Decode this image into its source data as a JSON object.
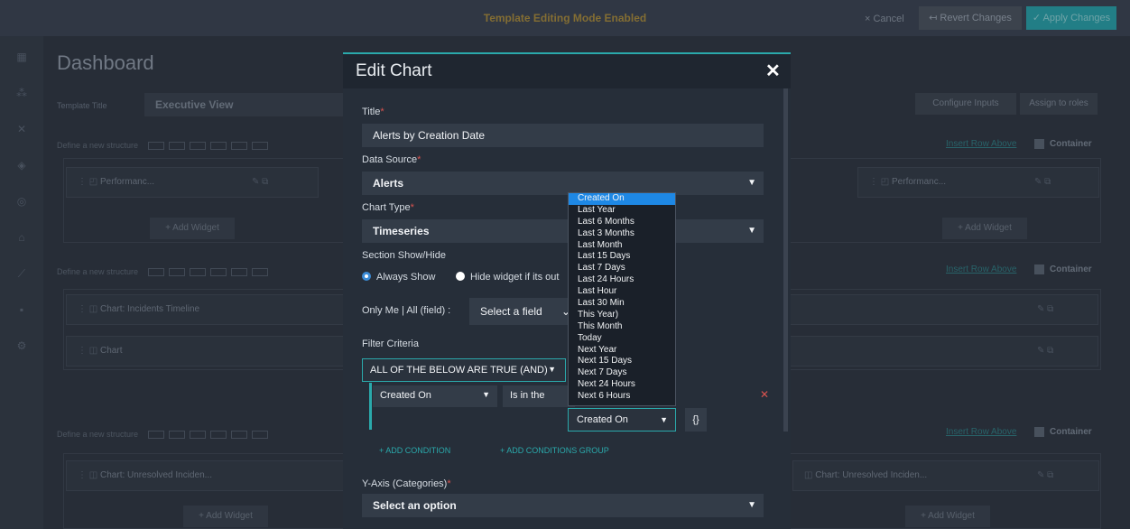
{
  "topbar": {
    "mode_text": "Template Editing Mode Enabled",
    "cancel_label": "× Cancel",
    "revert_label": "↤ Revert Changes",
    "apply_label": "✓ Apply Changes"
  },
  "dashboard": {
    "title": "Dashboard",
    "template_title_label": "Template Title",
    "template_title_value": "Executive View",
    "configure_inputs_label": "Configure Inputs",
    "assign_roles_label": "Assign to roles",
    "define_structure_label": "Define a new structure",
    "insert_row_label": "Insert Row Above",
    "container_label": "Container",
    "add_widget_label": "+ Add Widget",
    "row1_widgets": [
      "Performanc...",
      "Performanc..."
    ],
    "row2_widgets": [
      "Chart: Incidents Timeline",
      "Chart"
    ],
    "row3_widgets": [
      "Chart: Unresolved Inciden...",
      "Chart: Unresolved Inciden..."
    ]
  },
  "modal": {
    "title": "Edit Chart",
    "title_label": "Title",
    "title_value": "Alerts by Creation Date",
    "data_source_label": "Data Source",
    "data_source_value": "Alerts",
    "chart_type_label": "Chart Type",
    "chart_type_value": "Timeseries",
    "section_label": "Section Show/Hide",
    "always_show": "Always Show",
    "hide_widget": "Hide widget if its out",
    "only_me_label": "Only Me | All (field) :",
    "select_field": "Select a field",
    "filter_label": "Filter Criteria",
    "and_value": "ALL OF THE BELOW ARE TRUE (AND)",
    "cond_field": "Created On",
    "cond_op": "Is in the",
    "cond_value": "Created On",
    "braces": "{}",
    "add_condition": "+ ADD CONDITION",
    "add_group": "+ ADD CONDITIONS GROUP",
    "yaxis_label": "Y-Axis (Categories)",
    "yaxis_value": "Select an option"
  },
  "dropdown": {
    "options": [
      "Created On",
      "Last Year",
      "Last 6 Months",
      "Last 3 Months",
      "Last Month",
      "Last 15 Days",
      "Last 7 Days",
      "Last 24 Hours",
      "Last Hour",
      "Last 30 Min",
      "This Year)",
      "This Month",
      "Today",
      "Next Year",
      "Next 15 Days",
      "Next 7 Days",
      "Next 24 Hours",
      "Next 6 Hours"
    ],
    "selected": "Created On"
  }
}
